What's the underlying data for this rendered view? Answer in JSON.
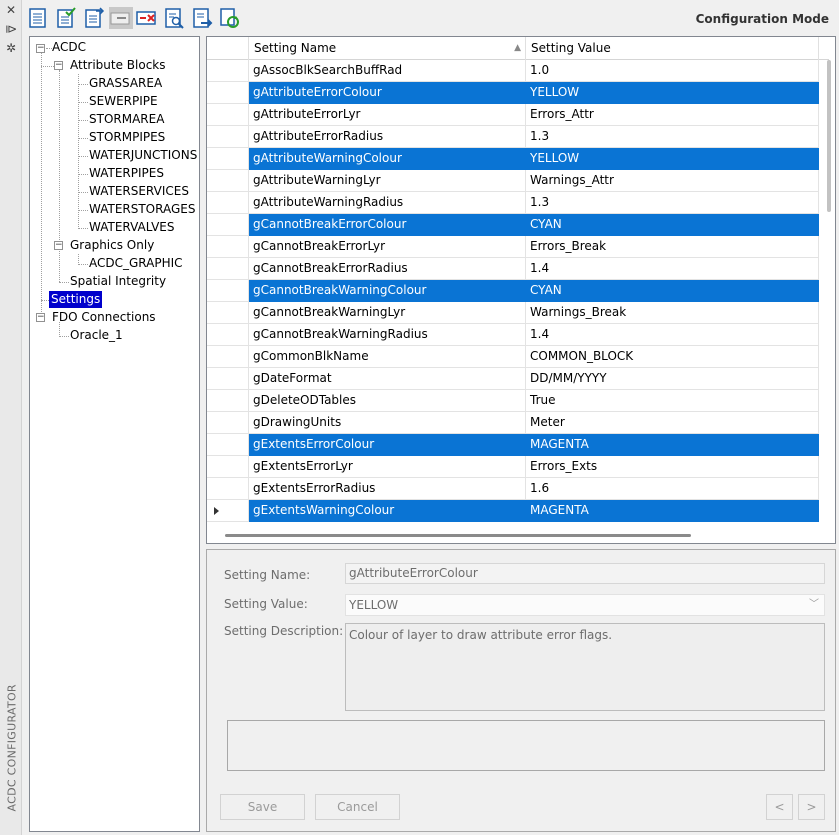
{
  "side_strip": {
    "label": "ACDC CONFIGURATOR",
    "buttons": [
      "close-icon",
      "pin-icon",
      "gear-icon"
    ]
  },
  "toolbar": {
    "mode_label": "Configuration Mode",
    "buttons": [
      "list-icon",
      "check-list-icon",
      "import-icon",
      "remove-icon",
      "delete-icon",
      "search-document-icon",
      "export-icon",
      "refresh-icon"
    ]
  },
  "tree": {
    "root": "ACDC",
    "attribute_blocks": {
      "label": "Attribute Blocks",
      "children": [
        "GRASSAREA",
        "SEWERPIPE",
        "STORMAREA",
        "STORMPIPES",
        "WATERJUNCTIONS",
        "WATERPIPES",
        "WATERSERVICES",
        "WATERSTORAGES",
        "WATERVALVES"
      ]
    },
    "graphics_only": {
      "label": "Graphics Only",
      "children": [
        "ACDC_GRAPHIC"
      ]
    },
    "spatial_integrity": "Spatial Integrity",
    "settings": "Settings",
    "fdo_connections": {
      "label": "FDO Connections",
      "children": [
        "Oracle_1"
      ]
    }
  },
  "grid": {
    "columns": [
      "Setting Name",
      "Setting Value"
    ],
    "rows": [
      {
        "name": "gAssocBlkSearchBuffRad",
        "value": "1.0",
        "selected": false
      },
      {
        "name": "gAttributeErrorColour",
        "value": "YELLOW",
        "selected": true
      },
      {
        "name": "gAttributeErrorLyr",
        "value": "Errors_Attr",
        "selected": false
      },
      {
        "name": "gAttributeErrorRadius",
        "value": "1.3",
        "selected": false
      },
      {
        "name": "gAttributeWarningColour",
        "value": "YELLOW",
        "selected": true
      },
      {
        "name": "gAttributeWarningLyr",
        "value": "Warnings_Attr",
        "selected": false
      },
      {
        "name": "gAttributeWarningRadius",
        "value": "1.3",
        "selected": false
      },
      {
        "name": "gCannotBreakErrorColour",
        "value": "CYAN",
        "selected": true
      },
      {
        "name": "gCannotBreakErrorLyr",
        "value": "Errors_Break",
        "selected": false
      },
      {
        "name": "gCannotBreakErrorRadius",
        "value": "1.4",
        "selected": false
      },
      {
        "name": "gCannotBreakWarningColour",
        "value": "CYAN",
        "selected": true
      },
      {
        "name": "gCannotBreakWarningLyr",
        "value": "Warnings_Break",
        "selected": false
      },
      {
        "name": "gCannotBreakWarningRadius",
        "value": "1.4",
        "selected": false
      },
      {
        "name": "gCommonBlkName",
        "value": "COMMON_BLOCK",
        "selected": false
      },
      {
        "name": "gDateFormat",
        "value": "DD/MM/YYYY",
        "selected": false
      },
      {
        "name": "gDeleteODTables",
        "value": "True",
        "selected": false
      },
      {
        "name": "gDrawingUnits",
        "value": "Meter",
        "selected": false
      },
      {
        "name": "gExtentsErrorColour",
        "value": "MAGENTA",
        "selected": true
      },
      {
        "name": "gExtentsErrorLyr",
        "value": "Errors_Exts",
        "selected": false
      },
      {
        "name": "gExtentsErrorRadius",
        "value": "1.6",
        "selected": false
      },
      {
        "name": "gExtentsWarningColour",
        "value": "MAGENTA",
        "selected": true
      }
    ]
  },
  "detail": {
    "name_label": "Setting Name:",
    "name_value": "gAttributeErrorColour",
    "value_label": "Setting Value:",
    "value_value": "YELLOW",
    "desc_label": "Setting Description:",
    "desc_value": "Colour of layer to draw attribute error flags.",
    "save_label": "Save",
    "cancel_label": "Cancel",
    "prev_label": "<",
    "next_label": ">"
  },
  "colors": {
    "selection": "#0a74d4",
    "tree_selection": "#0000cc"
  }
}
